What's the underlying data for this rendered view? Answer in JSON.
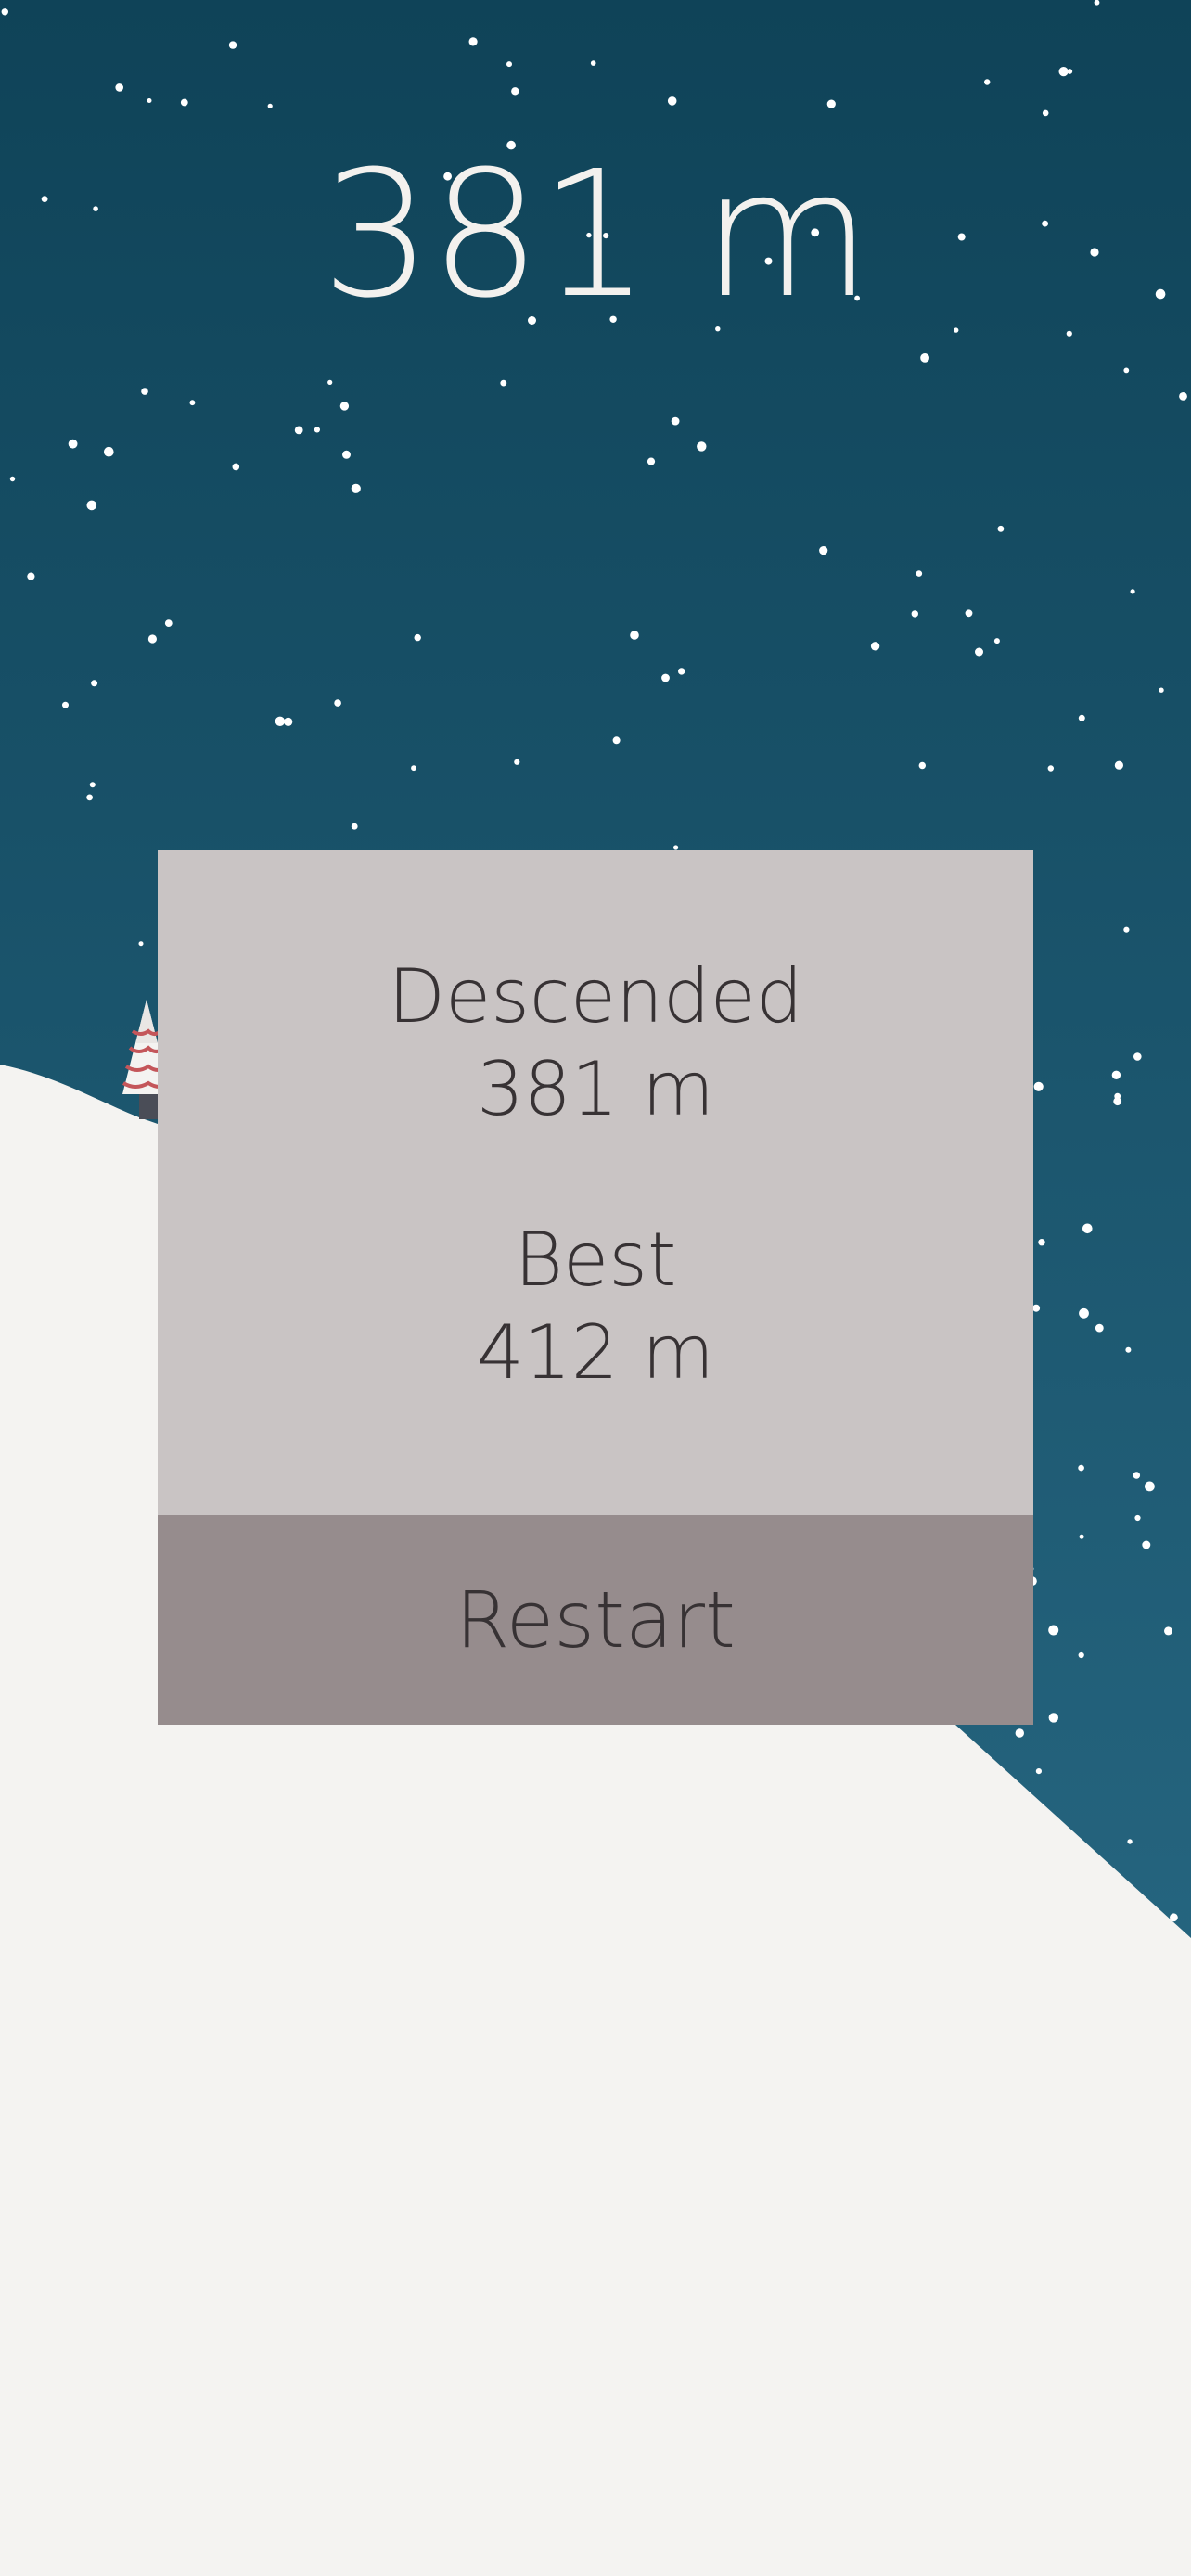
{
  "hud": {
    "distance": "381 m"
  },
  "game_over": {
    "descended_label": "Descended",
    "descended_value": "381 m",
    "best_label": "Best",
    "best_value": "412 m",
    "restart_label": "Restart"
  },
  "colors": {
    "sky_top": "#0f4358",
    "sky_bottom": "#2c6f8b",
    "snow": "#f4f3f1",
    "panel_bg": "#c9c4c4",
    "button_bg": "#968c8d",
    "text_dark": "#373234",
    "tree_ornament": "#c4565a"
  }
}
